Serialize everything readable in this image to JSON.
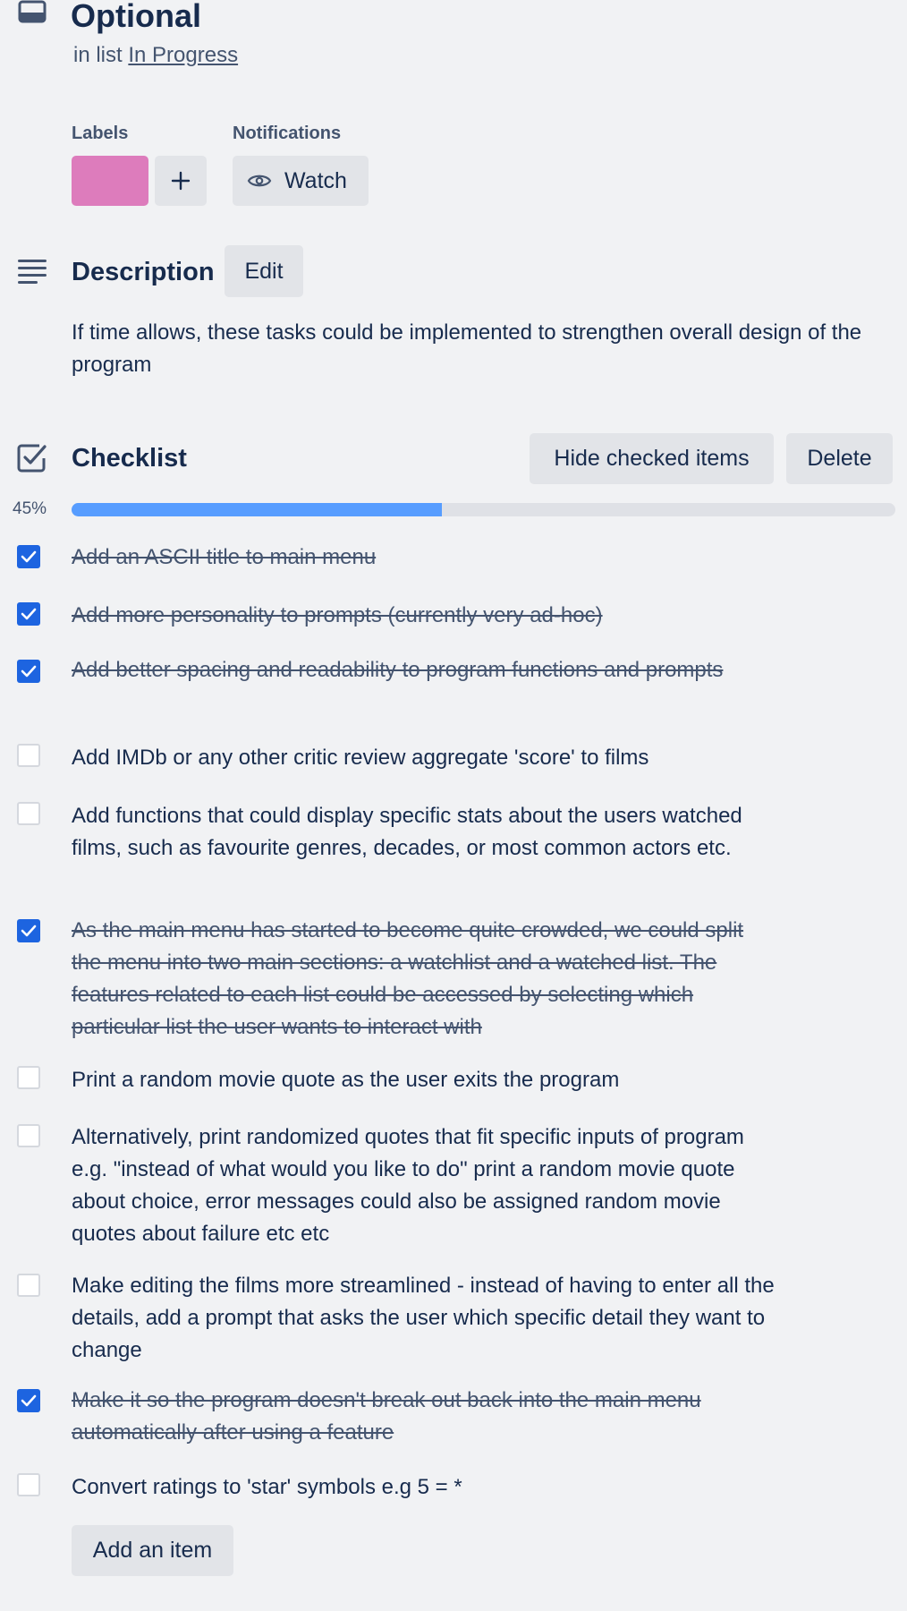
{
  "card": {
    "icon": "card-icon",
    "title": "Optional",
    "in_list_prefix": "in list",
    "list_name": "In Progress"
  },
  "labels": {
    "heading": "Labels",
    "chip_color": "#dd7cbc",
    "add_icon": "plus-icon"
  },
  "notifications": {
    "heading": "Notifications",
    "watch_label": "Watch",
    "watch_icon": "eye-icon"
  },
  "description": {
    "icon": "description-lines-icon",
    "heading": "Description",
    "edit_label": "Edit",
    "text": "If time allows, these tasks could be implemented to strengthen overall design of the program"
  },
  "checklist": {
    "icon": "checklist-icon",
    "heading": "Checklist",
    "hide_checked_label": "Hide checked items",
    "delete_label": "Delete",
    "progress_text": "45%",
    "progress_fraction": 0.45,
    "progress_color": "#579dff",
    "add_item_label": "Add an item",
    "items": [
      {
        "text": "Add an ASCII title to main menu",
        "checked": true
      },
      {
        "text": "Add more personality to prompts (currently very ad-hoc)",
        "checked": true
      },
      {
        "text": "Add better spacing and readability to program functions and prompts",
        "checked": true
      },
      {
        "text": "Add IMDb or any other critic review aggregate 'score' to films",
        "checked": false
      },
      {
        "text": "Add functions that could display specific stats about the users watched films, such as favourite genres, decades, or most common actors etc.",
        "checked": false
      },
      {
        "text": "As the main menu has started to become quite crowded, we could split the menu into two main sections: a watchlist and a watched list. The features related to each list could be accessed by selecting which particular list the user wants to interact with",
        "checked": true
      },
      {
        "text": "Print a random movie quote as the user exits the program",
        "checked": false
      },
      {
        "text": "Alternatively, print randomized quotes that fit specific inputs of program e.g. \"instead of what would you like to do\" print a random movie quote about choice, error messages could also be assigned random movie quotes about failure etc etc",
        "checked": false
      },
      {
        "text": "Make editing the films more streamlined - instead of having to enter all the details, add a prompt that asks the user which specific detail they want to change",
        "checked": false
      },
      {
        "text": "Make it so the program doesn't break out back into the main menu automatically after using a feature",
        "checked": true
      },
      {
        "text": "Convert ratings to 'star' symbols e.g 5 = *",
        "checked": false
      }
    ]
  }
}
